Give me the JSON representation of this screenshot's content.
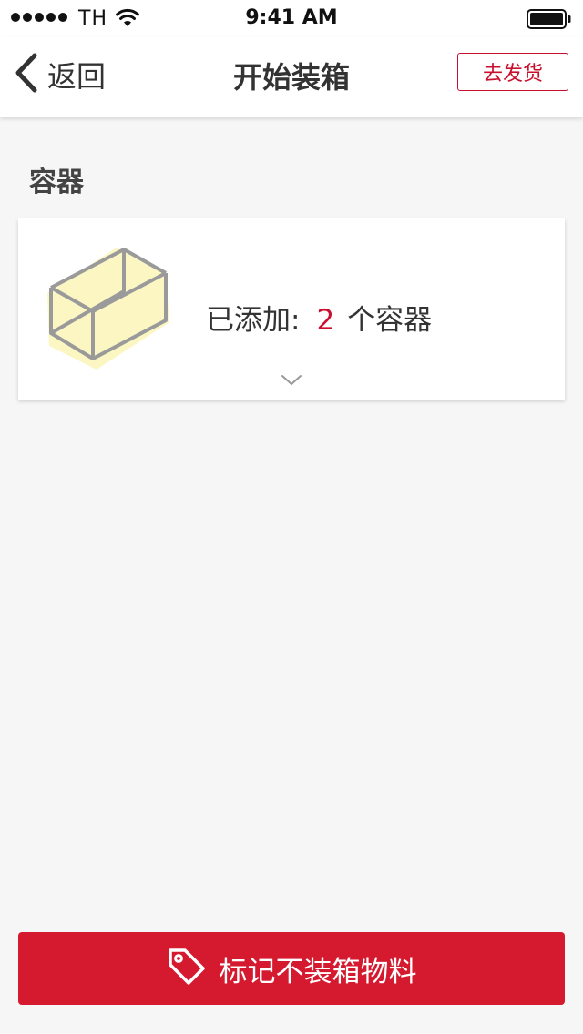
{
  "status_bar": {
    "carrier": "TH",
    "time": "9:41 AM"
  },
  "nav": {
    "back_label": "返回",
    "title": "开始装箱",
    "ship_label": "去发货"
  },
  "section": {
    "title": "容器"
  },
  "container_card": {
    "added_prefix": "已添加:",
    "count": "2",
    "unit_label": "个容器"
  },
  "bottom_button": {
    "label": "标记不装箱物料"
  },
  "colors": {
    "accent": "#c8102e",
    "button_bg": "#d51a30",
    "background": "#f6f6f6",
    "box_fill": "#fbf6c2",
    "box_stroke": "#9a9a9a"
  },
  "icons": [
    "signal-dots-icon",
    "wifi-icon",
    "battery-icon",
    "back-chevron-icon",
    "box-icon",
    "chevron-down-icon",
    "tag-icon"
  ]
}
